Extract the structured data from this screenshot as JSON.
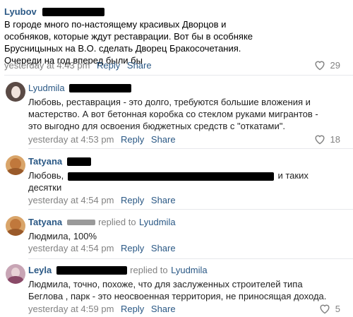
{
  "comments": [
    {
      "name": "Lyubov",
      "text": "В городе много по-настоящему красивых Дворцов и особняков, которые ждут реставрации. Вот бы в особняке Брусницыных на В.О. сделать Дворец Бракосочетания. Очереди на год вперед были бы",
      "time": "yesterday at 4:43 pm",
      "reply": "Reply",
      "share": "Share",
      "likes": "29"
    },
    {
      "name": "Lyudmila",
      "text": "Любовь, реставрация - это долго, требуются большие вложения и мастерство. А вот бетонная коробка со стеклом руками мигрантов - это выгодно для освоения бюджетных средств с \"откатами\".",
      "time": "yesterday at 4:53 pm",
      "reply": "Reply",
      "share": "Share",
      "likes": "18"
    },
    {
      "name": "Tatyana",
      "text_start": "Любовь,",
      "text_end": "и таких",
      "text_line2": "десятки",
      "time": "yesterday at 4:54 pm",
      "reply": "Reply",
      "share": "Share"
    },
    {
      "name": "Tatyana",
      "replied": "replied to",
      "replied_to": "Lyudmila",
      "text": "Людмила, 100%",
      "time": "yesterday at 4:54 pm",
      "reply": "Reply",
      "share": "Share"
    },
    {
      "name": "Leyla",
      "replied": "replied to",
      "replied_to": "Lyudmila",
      "text": "Людмила, точно, похоже, что для заслуженных строителей типа Беглова , парк - это неосвоенная территория, не приносящая дохода.",
      "time": "yesterday at 4:59 pm",
      "reply": "Reply",
      "share": "Share",
      "likes": "5"
    }
  ],
  "colors": {
    "link": "#2a5885",
    "muted": "#828282",
    "divider": "#e7e8ec"
  },
  "icons": {
    "like": "heart-outline-icon"
  }
}
